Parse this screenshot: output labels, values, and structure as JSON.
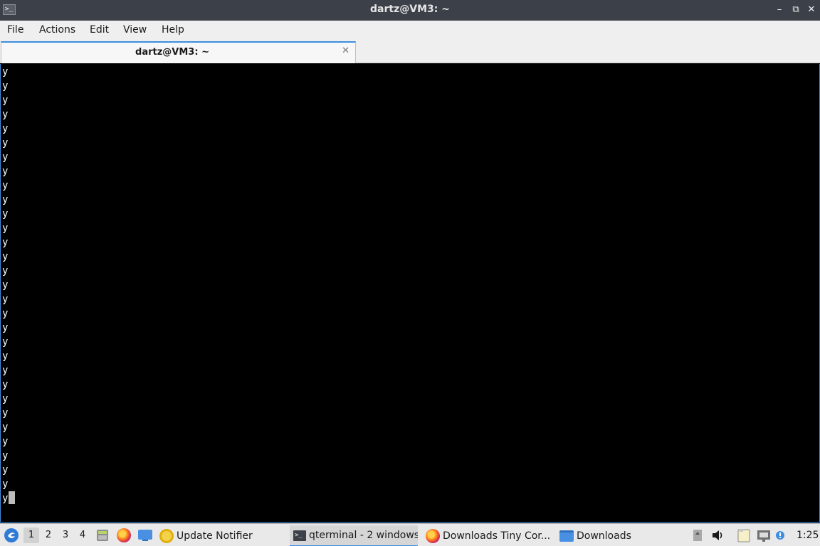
{
  "window": {
    "title": "dartz@VM3: ~",
    "app_icon_glyph": ">_",
    "buttons": {
      "minimize": "–",
      "maximize": "⧉",
      "close": "✕"
    }
  },
  "menu": {
    "items": [
      "File",
      "Actions",
      "Edit",
      "View",
      "Help"
    ]
  },
  "tab": {
    "label": "dartz@VM3: ~",
    "close_glyph": "✕"
  },
  "terminal": {
    "lines": [
      "y",
      "y",
      "y",
      "y",
      "y",
      "y",
      "y",
      "y",
      "y",
      "y",
      "y",
      "y",
      "y",
      "y",
      "y",
      "y",
      "y",
      "y",
      "y",
      "y",
      "y",
      "y",
      "y",
      "y",
      "y",
      "y",
      "y",
      "y",
      "y",
      "y",
      "y"
    ],
    "cursor_visible": true,
    "background": "#000000",
    "foreground": "#ffffff"
  },
  "taskbar": {
    "desktops": [
      "1",
      "2",
      "3",
      "4"
    ],
    "active_desktop": "1",
    "tasks": [
      {
        "label": "Update Notifier",
        "icon": "update-notifier-icon"
      },
      {
        "label": "qterminal - 2 windows",
        "icon": "terminal-icon",
        "active": true
      },
      {
        "label": "Downloads Tiny Cor...",
        "icon": "firefox-icon"
      },
      {
        "label": "Downloads",
        "icon": "folder-icon"
      }
    ],
    "clock": "1:25"
  },
  "colors": {
    "accent": "#3d8ee0",
    "titlebar": "#3c4048"
  }
}
